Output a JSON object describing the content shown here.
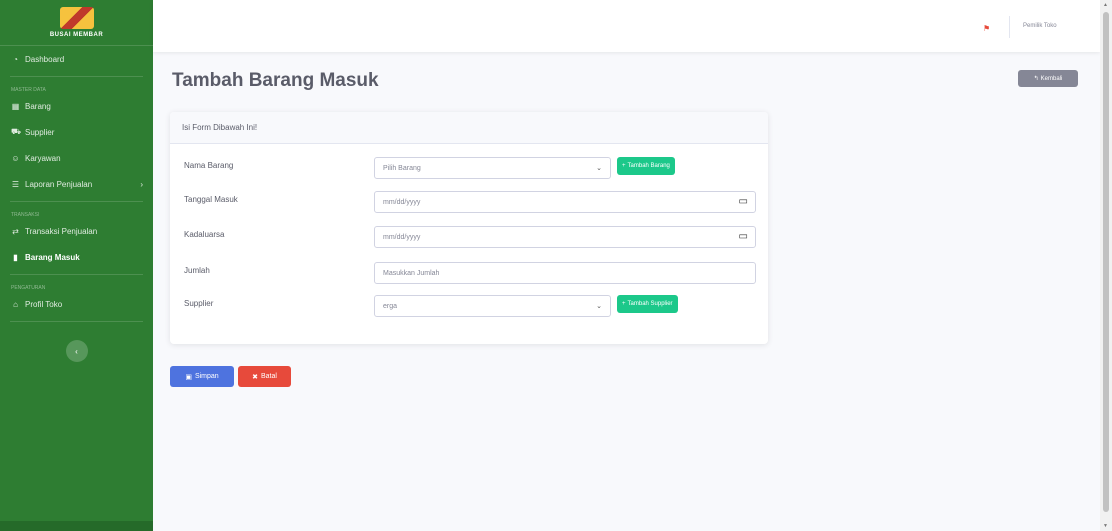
{
  "brand": {
    "name": "BUSAI MEMBAR"
  },
  "sidebar": {
    "items": [
      {
        "label": "Dashboard",
        "icon": "◔"
      },
      {
        "heading": "MASTER DATA"
      },
      {
        "label": "Barang",
        "icon": "▦"
      },
      {
        "label": "Supplier",
        "icon": "⛟"
      },
      {
        "label": "Karyawan",
        "icon": "☺"
      },
      {
        "label": "Laporan Penjualan",
        "icon": "☰",
        "caret": "›"
      },
      {
        "heading": "TRANSAKSI"
      },
      {
        "label": "Transaksi Penjualan",
        "icon": "⇄"
      },
      {
        "label": "Barang Masuk",
        "icon": "▮",
        "active": true
      },
      {
        "heading": "PENGATURAN"
      },
      {
        "label": "Profil Toko",
        "icon": "⌂"
      }
    ],
    "toggle_icon": "‹"
  },
  "topbar": {
    "flag_icon": "flag-icon",
    "user": "Pemilik Toko"
  },
  "page": {
    "title": "Tambah Barang Masuk",
    "back_label": "Kembali",
    "back_icon": "↰"
  },
  "form": {
    "header": "Isi Form Dibawah Ini!",
    "fields": {
      "nama_barang": {
        "label": "Nama Barang",
        "value": "Pilih Barang",
        "add_label": "Tambah Barang"
      },
      "tanggal_masuk": {
        "label": "Tanggal Masuk",
        "placeholder": "mm/dd/yyyy"
      },
      "kadaluarsa": {
        "label": "Kadaluarsa",
        "placeholder": "mm/dd/yyyy"
      },
      "jumlah": {
        "label": "Jumlah",
        "placeholder": "Masukkan Jumlah"
      },
      "supplier": {
        "label": "Supplier",
        "value": "erga",
        "add_label": "Tambah Supplier"
      }
    }
  },
  "actions": {
    "save_label": "Simpan",
    "cancel_label": "Batal"
  }
}
